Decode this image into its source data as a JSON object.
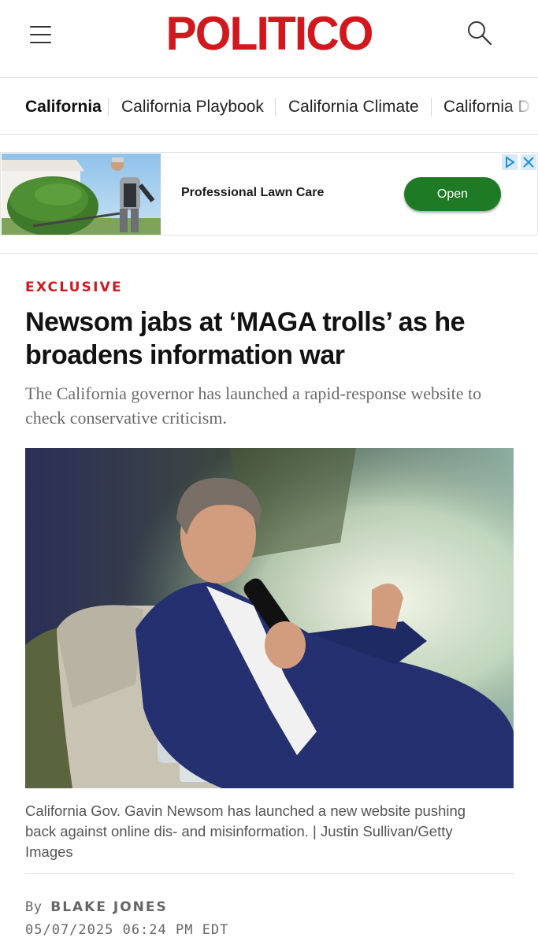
{
  "header": {
    "logo": "POLITICO",
    "brand_color": "#d1181f",
    "menu_icon": "hamburger-menu-icon",
    "search_icon": "search-icon"
  },
  "section_nav": {
    "items": [
      {
        "label": "California",
        "active": true
      },
      {
        "label": "California Playbook",
        "active": false
      },
      {
        "label": "California Climate",
        "active": false
      },
      {
        "label": "California D",
        "active": false
      }
    ]
  },
  "ad": {
    "title": "Professional Lawn Care",
    "button_label": "Open",
    "button_color": "#1e7a25",
    "choices_icon": "adchoices-icon",
    "close_icon": "close-icon"
  },
  "article": {
    "kicker": "EXCLUSIVE",
    "headline": "Newsom jabs at ‘MAGA trolls’ as he broadens information war",
    "dek": "The California governor has launched a rapid-response website to check conservative criticism.",
    "caption": "California Gov. Gavin Newsom has launched a new website pushing back against online dis- and misinformation. | Justin Sullivan/Getty Images",
    "byline_prefix": "By",
    "author": "BLAKE JONES",
    "date": "05/07/2025 06:24 PM EDT"
  }
}
